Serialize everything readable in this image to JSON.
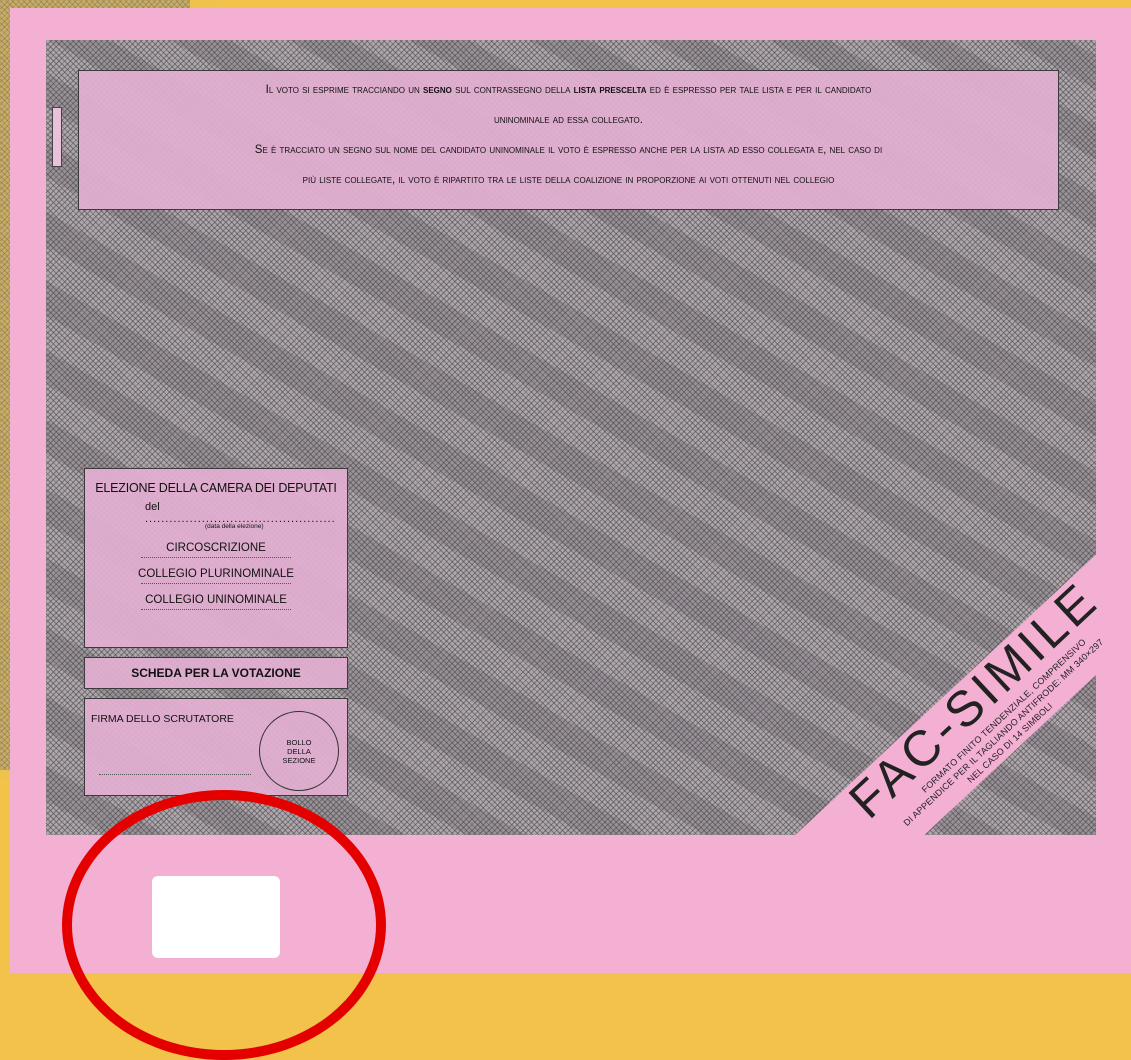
{
  "instructions": {
    "line1_part1": "Il voto si esprime tracciando un",
    "line1_bold1": "segno",
    "line1_part2": "sul contrassegno della",
    "line1_bold2": "lista prescelta",
    "line1_part3": "ed è espresso per tale lista e per il candidato",
    "line2": "uninominale ad essa collegato.",
    "line3": "Se è tracciato un segno sul nome del candidato uninominale il voto è espresso anche per la lista ad esso collegata e, nel caso di",
    "line4": "più liste collegate, il voto è ripartito tra le liste della coalizione in proporzione ai voti ottenuti nel collegio"
  },
  "election": {
    "title": "ELEZIONE DELLA CAMERA DEI DEPUTATI",
    "del_label": "del",
    "del_dots": "...............................................",
    "date_hint": "(data della elezione)",
    "circoscrizione": "CIRCOSCRIZIONE",
    "collegio_plurinominale": "COLLEGIO PLURINOMINALE",
    "collegio_uninominale": "COLLEGIO UNINOMINALE"
  },
  "scheda_label": "SCHEDA PER LA VOTAZIONE",
  "firma": {
    "label": "FIRMA DELLO SCRUTATORE",
    "bollo": "BOLLO DELLA SEZIONE"
  },
  "fac_simile": {
    "main": "FAC-SIMILE",
    "line1": "FORMATO FINITO TENDENZIALE, COMPRENSIVO",
    "line2": "DI APPENDICE PER IL TAGLIANDO ANTIFRODE: MM 340×297",
    "line3": "NEL CASO DI 14 SIMBOLI"
  },
  "colors": {
    "ballot_pink": "#f4b0d3",
    "highlight_red": "#e50000",
    "under_ballot_yellow": "#eec24d"
  }
}
